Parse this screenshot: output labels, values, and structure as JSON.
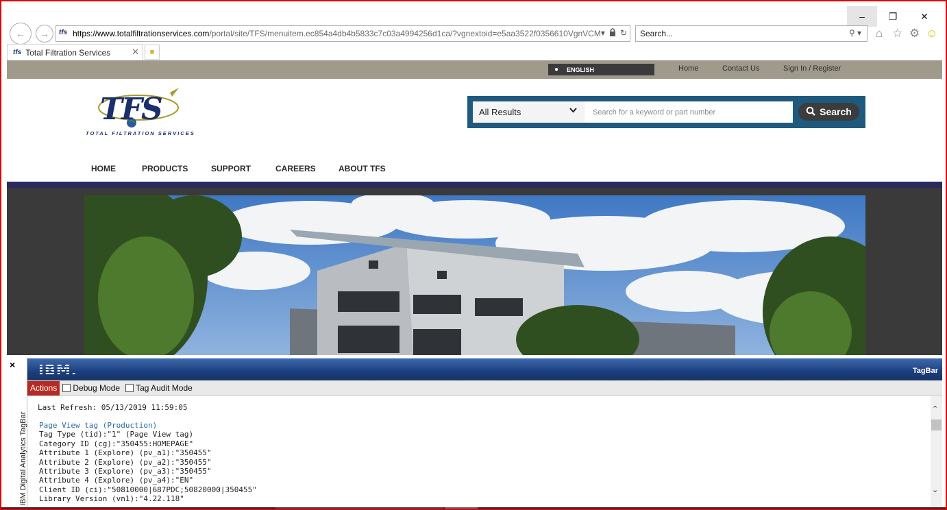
{
  "window": {
    "minimize": "–",
    "maximize": "❐",
    "close": "✕"
  },
  "address": {
    "host": "https://www.totalfiltrationservices.com",
    "path": "/portal/site/TFS/menuitem.ec854a4db4b5833c7c03a4994256d1ca/?vgnextoid=e5aa3522f0356610VgnVCM"
  },
  "browser_search": {
    "value": "Search...",
    "icon": "search-icon"
  },
  "tab": {
    "title": "Total Filtration Services"
  },
  "utility": {
    "language": "ENGLISH",
    "links": [
      "Home",
      "Contact Us",
      "Sign In / Register"
    ]
  },
  "logo": {
    "mark": "TFS",
    "tagline": "TOTAL FILTRATION SERVICES"
  },
  "site_search": {
    "scope": "All Results",
    "placeholder": "Search for a keyword or part number",
    "button": "Search"
  },
  "nav": [
    "HOME",
    "PRODUCTS",
    "SUPPORT",
    "CAREERS",
    "ABOUT TFS"
  ],
  "colors": {
    "accent": "#1f5a7e",
    "navrule": "#2a2a60",
    "tagbar": "#1b3e7d",
    "actions": "#b52a22"
  },
  "tagbar": {
    "close": "×",
    "side_label": "IBM Digital Analytics TagBar",
    "brand": "IBM.",
    "name": "TagBar",
    "actions": "Actions",
    "debug_mode": "Debug Mode",
    "tag_audit_mode": "Tag Audit Mode",
    "last_refresh": "Last Refresh: 05/13/2019 11:59:05",
    "lines": [
      "Page View tag (Production)",
      "Tag Type (tid):\"1\" (Page View tag)",
      "Category ID (cg):\"350455:HOMEPAGE\"",
      "Attribute 1 (Explore) (pv_a1):\"350455\"",
      "Attribute 2 (Explore) (pv_a2):\"350455\"",
      "Attribute 3 (Explore) (pv_a3):\"350455\"",
      "Attribute 4 (Explore) (pv_a4):\"EN\"",
      "Client ID (ci):\"50810000|687PDC;50820000|350455\"",
      "Library Version (vn1):\"4.22.118\""
    ]
  }
}
